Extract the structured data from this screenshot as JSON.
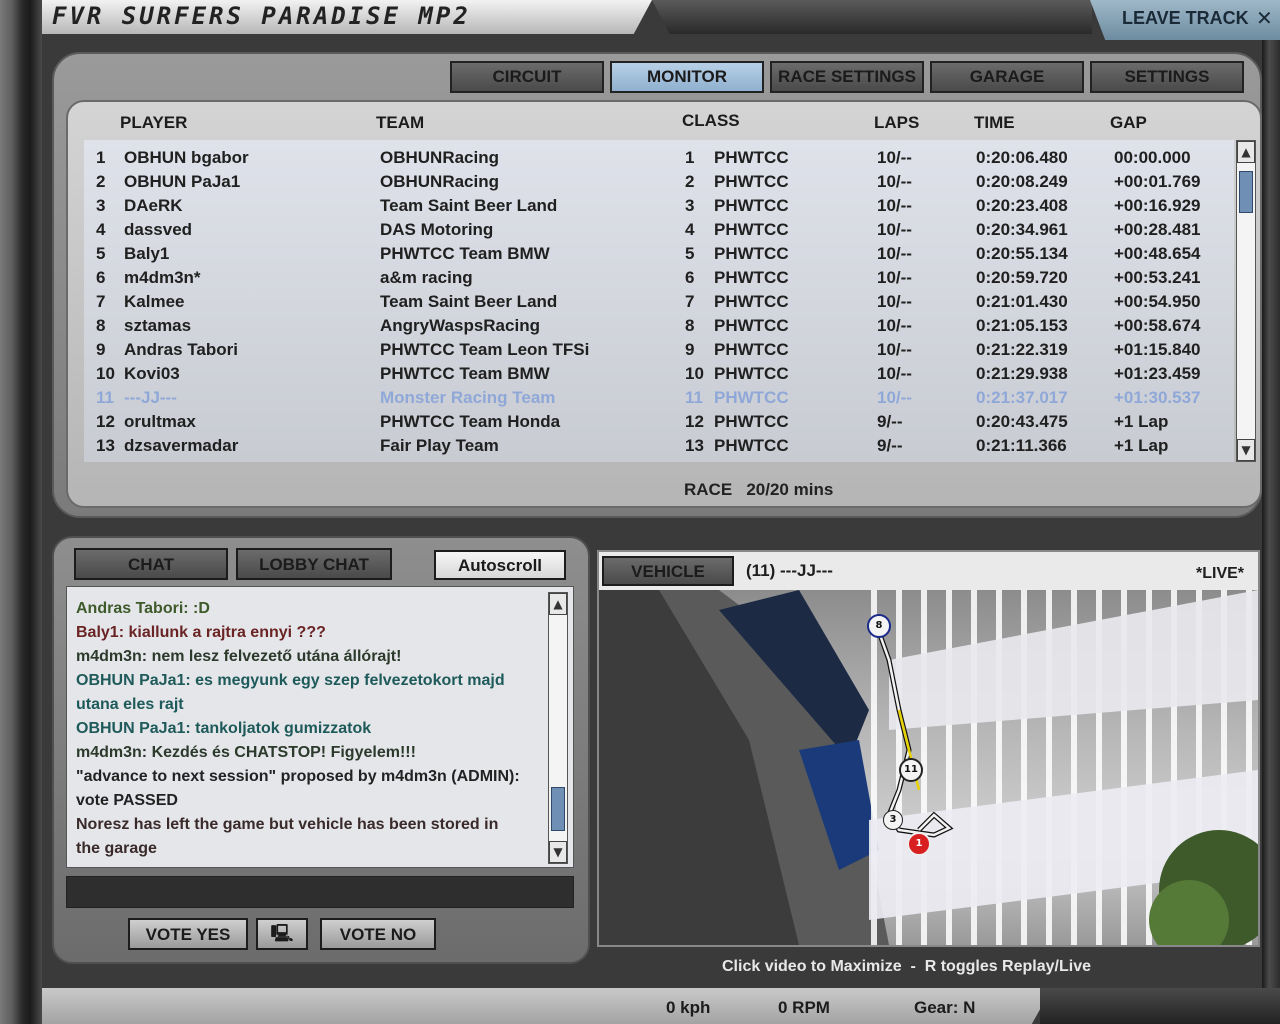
{
  "window": {
    "title": "FVR SURFERS PARADISE MP2",
    "leave_label": "LEAVE TRACK",
    "close_glyph": "✕"
  },
  "tabs": [
    {
      "label": "CIRCUIT"
    },
    {
      "label": "MONITOR"
    },
    {
      "label": "RACE SETTINGS"
    },
    {
      "label": "GARAGE"
    },
    {
      "label": "SETTINGS"
    }
  ],
  "table": {
    "headers": {
      "player": "PLAYER",
      "team": "TEAM",
      "class": "CLASS",
      "laps": "LAPS",
      "time": "TIME",
      "gap": "GAP"
    },
    "rows": [
      {
        "pos": "1",
        "player": "OBHUN bgabor",
        "team": "OBHUNRacing",
        "cpos": "1",
        "cls": "PHWTCC",
        "laps": "10/--",
        "time": "0:20:06.480",
        "gap": "00:00.000"
      },
      {
        "pos": "2",
        "player": "OBHUN PaJa1",
        "team": "OBHUNRacing",
        "cpos": "2",
        "cls": "PHWTCC",
        "laps": "10/--",
        "time": "0:20:08.249",
        "gap": "+00:01.769"
      },
      {
        "pos": "3",
        "player": "DAeRK",
        "team": "Team Saint Beer Land",
        "cpos": "3",
        "cls": "PHWTCC",
        "laps": "10/--",
        "time": "0:20:23.408",
        "gap": "+00:16.929"
      },
      {
        "pos": "4",
        "player": "dassved",
        "team": "DAS Motoring",
        "cpos": "4",
        "cls": "PHWTCC",
        "laps": "10/--",
        "time": "0:20:34.961",
        "gap": "+00:28.481"
      },
      {
        "pos": "5",
        "player": "Baly1",
        "team": "PHWTCC Team BMW",
        "cpos": "5",
        "cls": "PHWTCC",
        "laps": "10/--",
        "time": "0:20:55.134",
        "gap": "+00:48.654"
      },
      {
        "pos": "6",
        "player": "m4dm3n*",
        "team": "a&m racing",
        "cpos": "6",
        "cls": "PHWTCC",
        "laps": "10/--",
        "time": "0:20:59.720",
        "gap": "+00:53.241"
      },
      {
        "pos": "7",
        "player": "Kalmee",
        "team": "Team Saint Beer Land",
        "cpos": "7",
        "cls": "PHWTCC",
        "laps": "10/--",
        "time": "0:21:01.430",
        "gap": "+00:54.950"
      },
      {
        "pos": "8",
        "player": "sztamas",
        "team": "AngryWaspsRacing",
        "cpos": "8",
        "cls": "PHWTCC",
        "laps": "10/--",
        "time": "0:21:05.153",
        "gap": "+00:58.674"
      },
      {
        "pos": "9",
        "player": "Andras Tabori",
        "team": "PHWTCC Team Leon TFSi",
        "cpos": "9",
        "cls": "PHWTCC",
        "laps": "10/--",
        "time": "0:21:22.319",
        "gap": "+01:15.840"
      },
      {
        "pos": "10",
        "player": "Kovi03",
        "team": "PHWTCC Team BMW",
        "cpos": "10",
        "cls": "PHWTCC",
        "laps": "10/--",
        "time": "0:21:29.938",
        "gap": "+01:23.459"
      },
      {
        "pos": "11",
        "player": "---JJ---",
        "team": "Monster Racing Team",
        "cpos": "11",
        "cls": "PHWTCC",
        "laps": "10/--",
        "time": "0:21:37.017",
        "gap": "+01:30.537"
      },
      {
        "pos": "12",
        "player": "orultmax",
        "team": "PHWTCC Team Honda",
        "cpos": "12",
        "cls": "PHWTCC",
        "laps": "9/--",
        "time": "0:20:43.475",
        "gap": "+1 Lap"
      },
      {
        "pos": "13",
        "player": "dzsavermadar",
        "team": "Fair Play Team",
        "cpos": "13",
        "cls": "PHWTCC",
        "laps": "9/--",
        "time": "0:21:11.366",
        "gap": "+1 Lap"
      }
    ],
    "selected_row": 10
  },
  "race_status": "RACE   20/20 mins",
  "chat": {
    "tabs": {
      "chat": "CHAT",
      "lobby": "LOBBY CHAT"
    },
    "autoscroll": "Autoscroll",
    "lines": [
      {
        "text": "Andras Tabori: :D",
        "color": "#3f5a2a"
      },
      {
        "text": "Baly1: kiallunk a rajtra ennyi ???",
        "color": "#6a2424"
      },
      {
        "text": "m4dm3n: nem lesz felvezető utána állórajt!",
        "color": "#2c3a2c"
      },
      {
        "text": "OBHUN PaJa1: es megyunk egy szep felvezetokort majd",
        "color": "#1f5a5a"
      },
      {
        "text": "utana eles rajt",
        "color": "#1f5a5a"
      },
      {
        "text": "OBHUN PaJa1: tankoljatok gumizzatok",
        "color": "#1f5a5a"
      },
      {
        "text": "m4dm3n: Kezdés és CHATSTOP! Figyelem!!!",
        "color": "#2c3a2c"
      },
      {
        "text": "\"advance to next session\" proposed by m4dm3n (ADMIN):",
        "color": "#222222"
      },
      {
        "text": "vote PASSED",
        "color": "#222222"
      },
      {
        "text": "Noresz has left the game but vehicle has been stored in",
        "color": "#3a2a2a"
      },
      {
        "text": "the garage",
        "color": "#3a2a2a"
      }
    ],
    "vote_yes": "VOTE YES",
    "vote_no": "VOTE NO"
  },
  "video": {
    "tab": "VEHICLE",
    "vehicle": "(11) ---JJ---",
    "live": "*LIVE*",
    "markers": [
      "8",
      "11",
      "3",
      "1"
    ],
    "hint": "Click video to Maximize  -  R toggles Replay/Live"
  },
  "telemetry": {
    "speed": "0 kph",
    "rpm": "0 RPM",
    "gear": "Gear: N"
  }
}
